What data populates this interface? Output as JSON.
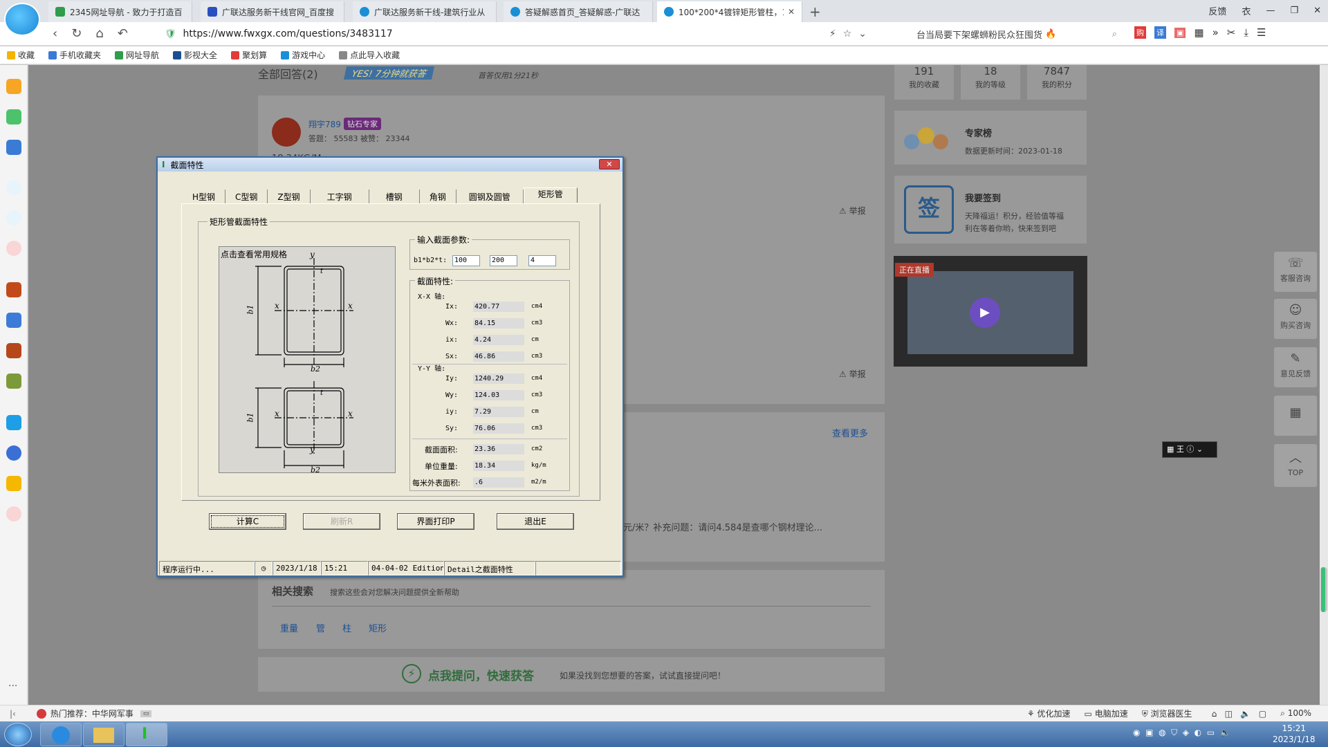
{
  "browser": {
    "tabs": [
      {
        "title": "2345网址导航 - 致力于打造百",
        "color": "#2f9d4a"
      },
      {
        "title": "广联达服务新干线官网_百度搜",
        "color": "#2a4fbf"
      },
      {
        "title": "广联达服务新干线-建筑行业从",
        "color": "#1b8fd6"
      },
      {
        "title": "答疑解惑首页_答疑解惑-广联达",
        "color": "#1b8fd6"
      },
      {
        "title": "100*200*4镀锌矩形管柱，10",
        "color": "#1b8fd6"
      }
    ],
    "new_tab": "+",
    "window_controls": {
      "feedback": "反馈",
      "skin": "衣",
      "min": "—",
      "max": "❐",
      "close": "✕"
    },
    "url": "https://www.fwxgx.com/questions/3483117",
    "search_text": "台当局要下架螺蛳粉民众狂囤货",
    "bookmarks": [
      {
        "label": "收藏",
        "color": "#f4b400"
      },
      {
        "label": "手机收藏夹",
        "color": "#3a7bd5"
      },
      {
        "label": "网址导航",
        "color": "#2f9d4a"
      },
      {
        "label": "影视大全",
        "color": "#1b4f92"
      },
      {
        "label": "聚划算",
        "color": "#e23b3b"
      },
      {
        "label": "游戏中心",
        "color": "#1b8fd6"
      },
      {
        "label": "点此导入收藏",
        "color": "#888888"
      }
    ]
  },
  "page": {
    "answers_heading": "全部回答(2)",
    "badge_text": "YES! 7分钟就获答",
    "badge_sub": "首答仅用1分21秒",
    "stats": [
      {
        "num": "191",
        "label": "我的收藏"
      },
      {
        "num": "18",
        "label": "我的等级"
      },
      {
        "num": "7847",
        "label": "我的积分"
      }
    ],
    "answerer": {
      "name": "翔宇789",
      "tag": "钻石专家",
      "meta": "答题： 55583   被赞： 23344",
      "first_line": "18.34KG/M"
    },
    "report1": "举报",
    "report2": "举报",
    "see_more": "查看更多",
    "related_text": "元/米？补充问题：请问4.584是查哪个钢材理论...",
    "experts": {
      "title": "专家榜",
      "updated": "数据更新时间：2023-01-18"
    },
    "signin": {
      "icon_text": "签",
      "title": "我要签到",
      "desc1": "天降福运！积分，经验值等福",
      "desc2": "利在等着你哟，快来签到吧"
    },
    "live_badge": "正在直播",
    "related_search": {
      "title": "相关搜索",
      "subtitle": "搜索这些会对您解决问题提供全新帮助",
      "tags": [
        "重量",
        "管",
        "柱",
        "矩形"
      ]
    },
    "ask": {
      "title": "点我提问，快速获答",
      "desc": "如果没找到您想要的答案，试试直接提问吧！"
    },
    "float_tools": [
      {
        "icon": "☏",
        "label": "客服咨询"
      },
      {
        "icon": "☺",
        "label": "购买咨询"
      },
      {
        "icon": "✎",
        "label": "意见反馈"
      },
      {
        "icon": "▦",
        "label": ""
      },
      {
        "icon": "︿",
        "label": "TOP"
      }
    ]
  },
  "dialog": {
    "title": "截面特性",
    "tabs": [
      "H型钢",
      "C型钢",
      "Z型钢",
      "工字钢",
      "槽钢",
      "角钢",
      "圆钢及圆管",
      "矩形管"
    ],
    "group_title": "矩形管截面特性",
    "drawing_caption": "点击查看常用规格",
    "axis_labels": {
      "y": "y",
      "x": "x",
      "b1": "b1",
      "b2": "b2",
      "t": "t"
    },
    "inputs": {
      "title": "输入截面参数:",
      "label": "b1*b2*t:",
      "b1": "100",
      "b2": "200",
      "t": "4"
    },
    "props_title": "截面特性:",
    "xx_title": "X-X 轴:",
    "yy_title": "Y-Y 轴:",
    "xx": [
      {
        "label": "Ix:",
        "value": "420.77",
        "unit": "cm4"
      },
      {
        "label": "Wx:",
        "value": "84.15",
        "unit": "cm3"
      },
      {
        "label": "ix:",
        "value": "4.24",
        "unit": "cm"
      },
      {
        "label": "Sx:",
        "value": "46.86",
        "unit": "cm3"
      }
    ],
    "yy": [
      {
        "label": "Iy:",
        "value": "1240.29",
        "unit": "cm4"
      },
      {
        "label": "Wy:",
        "value": "124.03",
        "unit": "cm3"
      },
      {
        "label": "iy:",
        "value": "7.29",
        "unit": "cm"
      },
      {
        "label": "Sy:",
        "value": "76.06",
        "unit": "cm3"
      }
    ],
    "extra": [
      {
        "label": "截面面积:",
        "value": "23.36",
        "unit": "cm2"
      },
      {
        "label": "单位重量:",
        "value": "18.34",
        "unit": "kg/m"
      },
      {
        "label": "每米外表面积:",
        "value": ".6",
        "unit": "m2/m"
      }
    ],
    "buttons": {
      "calc": "计算C",
      "refresh": "刷新R",
      "print": "界面打印P",
      "exit": "退出E"
    },
    "status": {
      "state": "程序运行中...",
      "date": "2023/1/18",
      "time": "15:21",
      "edition": "04-04-02 Edition",
      "detail": "Detail之截面特性"
    }
  },
  "statusbar": {
    "hot": "热门推荐：中华网军事",
    "items": [
      "优化加速",
      "电脑加速",
      "浏览器医生"
    ],
    "zoom": "100%"
  },
  "taskbar": {
    "time": "15:21",
    "date": "2023/1/18"
  }
}
